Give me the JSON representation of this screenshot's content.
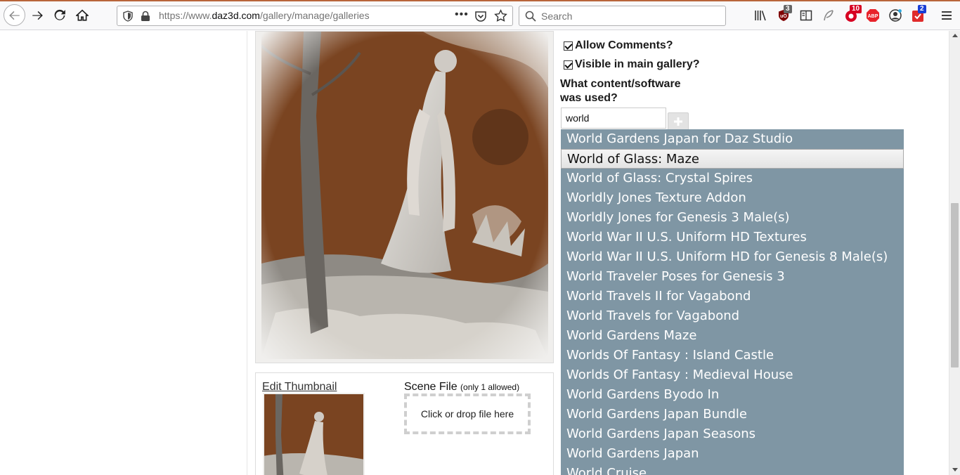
{
  "browser": {
    "url_prefix": "https://www.",
    "url_host": "daz3d.com",
    "url_path": "/gallery/manage/galleries",
    "search_placeholder": "Search",
    "badges": {
      "ublock": "3",
      "ext_red": "10",
      "ext_blue": "2"
    },
    "abp_label": "ABP",
    "accent_color": "#b8653a"
  },
  "form": {
    "allow_comments": {
      "label": "Allow Comments?",
      "checked": true
    },
    "visible_main_gallery": {
      "label": "Visible in main gallery?",
      "checked": true
    },
    "content_question": "What content/software was used?",
    "content_input_value": "world"
  },
  "autocomplete": {
    "background_color": "#7f96a4",
    "active_index": 1,
    "items": [
      "World Gardens Japan for Daz Studio",
      "World of Glass: Maze",
      "World of Glass: Crystal Spires",
      "Worldly Jones Texture Addon",
      "Worldly Jones for Genesis 3 Male(s)",
      "World War II U.S. Uniform HD Textures",
      "World War II U.S. Uniform HD for Genesis 8 Male(s)",
      "World Traveler Poses for Genesis 3",
      "World Travels II for Vagabond",
      "World Travels for Vagabond",
      "World Gardens Maze",
      "Worlds Of Fantasy : Island Castle",
      "Worlds Of Fantasy : Medieval House",
      "World Gardens Byodo In",
      "World Gardens Japan Bundle",
      "World Gardens Japan Seasons",
      "World Gardens Japan",
      "World Cruise"
    ]
  },
  "thumbnail_panel": {
    "edit_thumbnail": "Edit Thumbnail",
    "scene_file_label": "Scene File",
    "scene_file_note": "(only 1 allowed)",
    "dropzone_text": "Click or drop file here"
  }
}
